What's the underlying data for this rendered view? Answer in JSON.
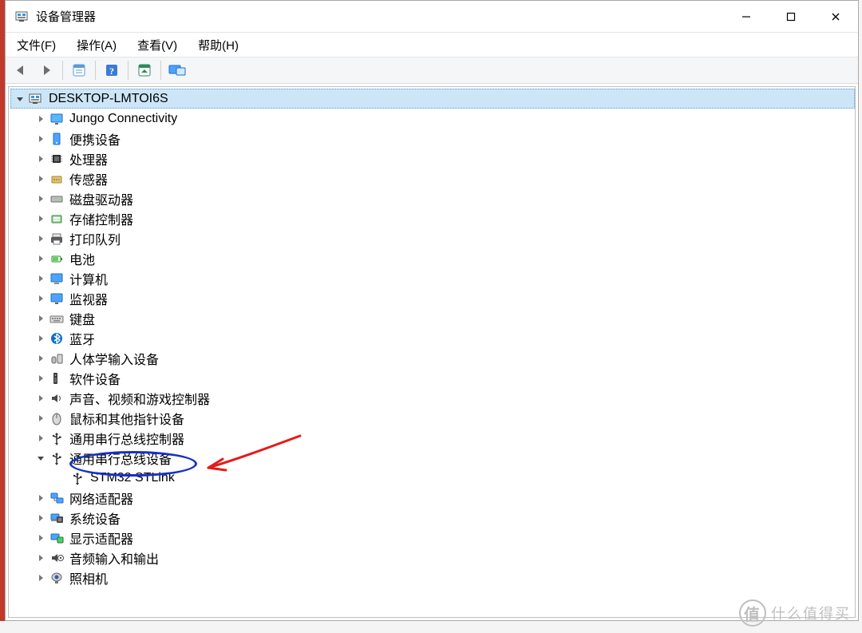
{
  "window": {
    "title": "设备管理器"
  },
  "menu": {
    "file": "文件(F)",
    "action": "操作(A)",
    "view": "查看(V)",
    "help": "帮助(H)"
  },
  "toolbar": {
    "back": "back",
    "forward": "forward",
    "show_hidden": "show-hidden",
    "help": "help",
    "scan": "scan-hardware",
    "remote": "remote"
  },
  "tree": {
    "root": {
      "label": "DESKTOP-LMTOI6S",
      "expanded": true
    },
    "items": [
      {
        "label": "Jungo Connectivity",
        "icon": "monitor-blue",
        "expanded": false
      },
      {
        "label": "便携设备",
        "icon": "device-portable",
        "expanded": false
      },
      {
        "label": "处理器",
        "icon": "cpu",
        "expanded": false
      },
      {
        "label": "传感器",
        "icon": "sensor",
        "expanded": false
      },
      {
        "label": "磁盘驱动器",
        "icon": "disk",
        "expanded": false
      },
      {
        "label": "存储控制器",
        "icon": "storage-ctrl",
        "expanded": false
      },
      {
        "label": "打印队列",
        "icon": "printer",
        "expanded": false
      },
      {
        "label": "电池",
        "icon": "battery",
        "expanded": false
      },
      {
        "label": "计算机",
        "icon": "computer",
        "expanded": false
      },
      {
        "label": "监视器",
        "icon": "monitor",
        "expanded": false
      },
      {
        "label": "键盘",
        "icon": "keyboard",
        "expanded": false
      },
      {
        "label": "蓝牙",
        "icon": "bluetooth",
        "expanded": false
      },
      {
        "label": "人体学输入设备",
        "icon": "hid",
        "expanded": false
      },
      {
        "label": "软件设备",
        "icon": "software",
        "expanded": false
      },
      {
        "label": "声音、视频和游戏控制器",
        "icon": "sound",
        "expanded": false
      },
      {
        "label": "鼠标和其他指针设备",
        "icon": "mouse",
        "expanded": false
      },
      {
        "label": "通用串行总线控制器",
        "icon": "usb",
        "expanded": false
      },
      {
        "label": "通用串行总线设备",
        "icon": "usb",
        "expanded": true,
        "children": [
          {
            "label": "STM32 STLink",
            "icon": "usb"
          }
        ]
      },
      {
        "label": "网络适配器",
        "icon": "network",
        "expanded": false
      },
      {
        "label": "系统设备",
        "icon": "system",
        "expanded": false
      },
      {
        "label": "显示适配器",
        "icon": "display-adapter",
        "expanded": false
      },
      {
        "label": "音频输入和输出",
        "icon": "audio-io",
        "expanded": false
      },
      {
        "label": "照相机",
        "icon": "camera",
        "expanded": false
      }
    ]
  },
  "watermark": {
    "text": "什么值得买",
    "symbol": "值"
  }
}
